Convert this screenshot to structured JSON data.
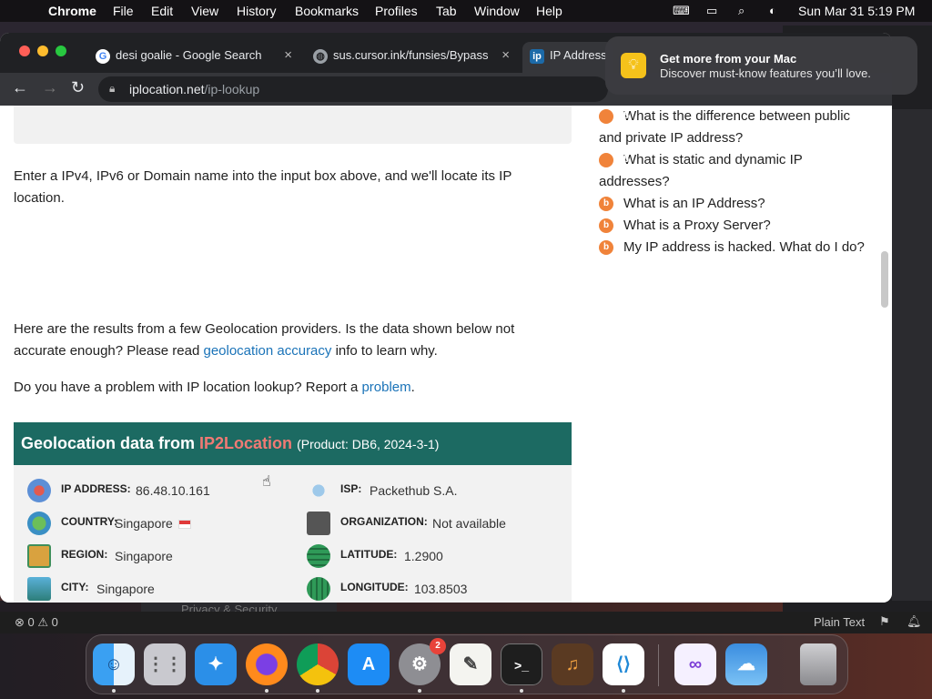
{
  "menubar": {
    "app_name": "Chrome",
    "items": [
      "File",
      "Edit",
      "View",
      "History",
      "Bookmarks",
      "Profiles",
      "Tab",
      "Window",
      "Help"
    ],
    "clock": "Sun Mar 31  5:19 PM"
  },
  "browser": {
    "tabs": [
      {
        "title": "desi goalie - Google Search",
        "icon": "google-icon"
      },
      {
        "title": "sus.cursor.ink/funsies/Bypass",
        "icon": "globe-icon"
      },
      {
        "title": "IP Address",
        "icon": "iplocation-icon"
      }
    ],
    "url_host": "iplocation.net",
    "url_path": "/ip-lookup"
  },
  "notification": {
    "title": "Get more from your Mac",
    "body": "Discover must-know features you’ll love."
  },
  "page": {
    "intro": "Enter a IPv4, IPv6 or Domain name into the input box above, and we'll locate its IP location.",
    "results_text_1": "Here are the results from a few Geolocation providers. Is the data shown below not accurate enough? Please read ",
    "results_link": "geolocation accuracy",
    "results_text_2": " info to learn why.",
    "problem_text": "Do you have a problem with IP location lookup? Report a ",
    "problem_link": "problem",
    "problem_end": ".",
    "geo_header_prefix": "Geolocation data from ",
    "geo_header_provider": "IP2Location",
    "geo_header_product": "(Product: DB6, 2024-3-1)",
    "fields_left": [
      {
        "label": "IP ADDRESS:",
        "value": "86.48.10.161",
        "icon": "map-pin-icon"
      },
      {
        "label": "COUNTRY:",
        "value": "Singapore",
        "icon": "globe-icon"
      },
      {
        "label": "REGION:",
        "value": "Singapore",
        "icon": "map-region-icon"
      },
      {
        "label": "CITY:",
        "value": "Singapore",
        "icon": "city-icon"
      }
    ],
    "fields_right": [
      {
        "label": "ISP:",
        "value": "Packethub S.A.",
        "icon": "antenna-icon"
      },
      {
        "label": "ORGANIZATION:",
        "value": "Not available",
        "icon": "building-icon"
      },
      {
        "label": "LATITUDE:",
        "value": "1.2900",
        "icon": "latitude-globe-icon"
      },
      {
        "label": "LONGITUDE:",
        "value": "103.8503",
        "icon": "longitude-globe-icon"
      }
    ],
    "faq": [
      "What is the difference between public and private IP address?",
      "What is static and dynamic IP addresses?",
      "What is an IP Address?",
      "What is a Proxy Server?",
      "My IP address is hacked. What do I do?"
    ]
  },
  "background_app": {
    "status_left": "⊗ 0 ⚠ 0",
    "language": "Plain Text",
    "sidebar_item": "Privacy & Security"
  },
  "dock": {
    "apps": [
      "Finder",
      "Launchpad",
      "Safari",
      "Firefox",
      "Chrome",
      "App Store",
      "System Settings",
      "TextEdit",
      "Terminal",
      "GarageBand",
      "VS Code",
      "Visual Studio",
      "Weather",
      "Trash"
    ],
    "settings_badge": "2"
  }
}
